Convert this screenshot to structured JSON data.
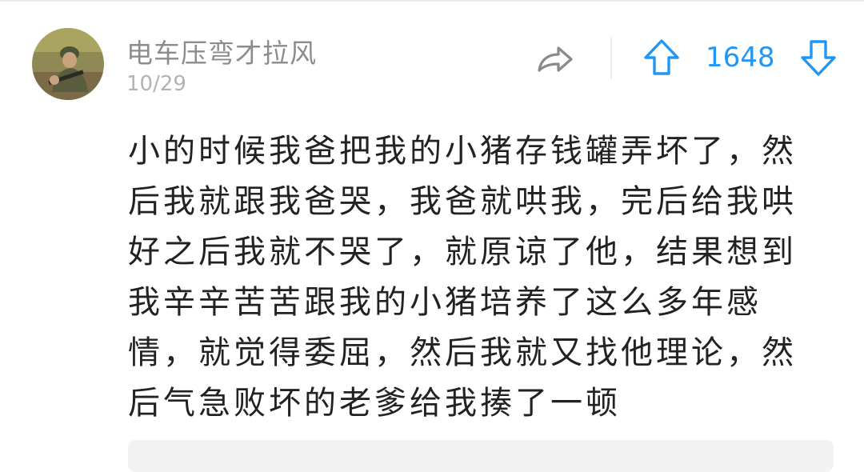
{
  "comment": {
    "username": "电车压弯才拉风",
    "date": "10/29",
    "vote_count": "1648",
    "body": "小的时候我爸把我的小猪存钱罐弄坏了，然后我就跟我爸哭，我爸就哄我，完后给我哄好之后我就不哭了，就原谅了他，结果想到我辛辛苦苦跟我的小猪培养了这么多年感情，就觉得委屈，然后我就又找他理论，然后气急败坏的老爹给我揍了一顿"
  },
  "icons": {
    "share": "share-icon",
    "upvote": "upvote-arrow-icon",
    "downvote": "downvote-arrow-icon",
    "avatar": "avatar"
  },
  "colors": {
    "accent": "#2196f3",
    "username": "#8c8c8c",
    "date": "#b3b3b3",
    "text": "#222222"
  }
}
